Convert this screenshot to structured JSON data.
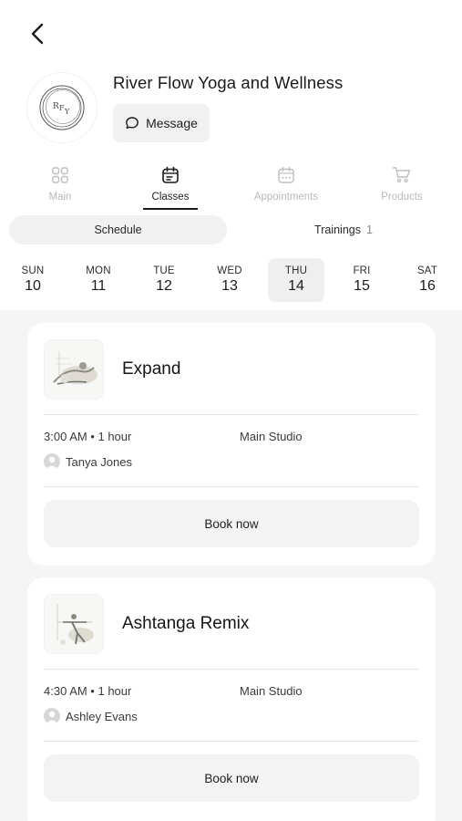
{
  "header": {
    "studio_name": "River Flow Yoga and Wellness",
    "logo_text": "RFY",
    "message_label": "Message"
  },
  "tabs": [
    {
      "label": "Main",
      "icon": "grid-icon",
      "active": false
    },
    {
      "label": "Classes",
      "icon": "calendar-icon",
      "active": true
    },
    {
      "label": "Appointments",
      "icon": "calendar-dots-icon",
      "active": false
    },
    {
      "label": "Products",
      "icon": "cart-icon",
      "active": false
    }
  ],
  "segments": {
    "schedule_label": "Schedule",
    "trainings_label": "Trainings",
    "trainings_count": "1"
  },
  "week": [
    {
      "name": "SUN",
      "num": "10"
    },
    {
      "name": "MON",
      "num": "11"
    },
    {
      "name": "TUE",
      "num": "12"
    },
    {
      "name": "WED",
      "num": "13"
    },
    {
      "name": "THU",
      "num": "14",
      "selected": true
    },
    {
      "name": "FRI",
      "num": "15"
    },
    {
      "name": "SAT",
      "num": "16"
    }
  ],
  "classes": [
    {
      "title": "Expand",
      "time": "3:00 AM • 1 hour",
      "room": "Main Studio",
      "instructor": "Tanya Jones",
      "book_label": "Book now"
    },
    {
      "title": "Ashtanga Remix",
      "time": "4:30 AM • 1 hour",
      "room": "Main Studio",
      "instructor": "Ashley Evans",
      "book_label": "Book now"
    }
  ],
  "colors": {
    "accent": "#1a1a1a",
    "muted": "#b9b9b9",
    "surface": "#f1f1f1",
    "background": "#f5f5f5"
  }
}
